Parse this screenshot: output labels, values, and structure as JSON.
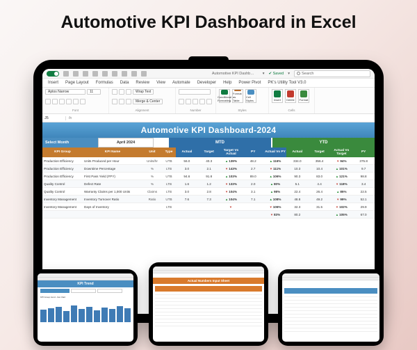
{
  "page_title": "Automotive KPI Dashboard in Excel",
  "qat": {
    "doc_name": "Automotive KPI Dashb…",
    "saved": "Saved",
    "search_placeholder": "Search"
  },
  "tabs": [
    "Insert",
    "Page Layout",
    "Formulas",
    "Data",
    "Review",
    "View",
    "Automate",
    "Developer",
    "Help",
    "Power Pivot",
    "PK's Utility Tool V3.0"
  ],
  "ribbon": {
    "font_family": "Aptos Narrow",
    "font_size": "11",
    "groups": {
      "font": "Font",
      "alignment": "Alignment",
      "number": "Number",
      "styles": "Styles",
      "cells": "Cells"
    },
    "cell_buttons": {
      "cond": "Conditional Formatting",
      "fmt_tbl": "Format as Table",
      "styles": "Cell Styles",
      "insert": "Insert",
      "delete": "Delete",
      "format": "Format"
    },
    "align": {
      "merge": "Merge & Center",
      "wrap": "Wrap Text"
    }
  },
  "formula_bar": {
    "name_box": "J5",
    "fx": "fx"
  },
  "dashboard": {
    "title": "Automotive KPI Dashboard-2024",
    "select_month_label": "Select Month",
    "select_month_value": "April 2024",
    "mtd_label": "MTD",
    "ytd_label": "YTD",
    "columns": {
      "group": "KPI Group",
      "name": "KPI Name",
      "unit": "Unit",
      "type": "Type",
      "actual": "Actual",
      "target": "Target",
      "tva": "Target Vs Actual",
      "py": "PY",
      "avp": "Actual Vs PY",
      "y_actual": "Actual",
      "y_target": "Target",
      "y_tva": "Actual Vs Target",
      "y_py": "PY"
    },
    "rows": [
      {
        "group": "Production Efficiency",
        "name": "Units Produced per Hour",
        "unit": "Units/hr",
        "type": "UTB",
        "m_actual": "56.0",
        "m_target": "40.3",
        "m_tva": "139%",
        "m_tva_dir": "up",
        "m_py": "48.2",
        "m_avp": "116%",
        "m_avp_dir": "up",
        "y_actual": "334.0",
        "y_target": "356.4",
        "y_tva": "94%",
        "y_tva_dir": "dn",
        "y_py": "375.8"
      },
      {
        "group": "Production Efficiency",
        "name": "Downtime Percentage",
        "unit": "%",
        "type": "LTB",
        "m_actual": "3.0",
        "m_target": "2.1",
        "m_tva": "143%",
        "m_tva_dir": "dn",
        "m_py": "2.7",
        "m_avp": "111%",
        "m_avp_dir": "dn",
        "y_actual": "10.3",
        "y_target": "10.4",
        "y_tva": "101%",
        "y_tva_dir": "up",
        "y_py": "9.7"
      },
      {
        "group": "Production Efficiency",
        "name": "First Pass Yield (FPY)",
        "unit": "%",
        "type": "UTB",
        "m_actual": "94.6",
        "m_target": "91.8",
        "m_tva": "103%",
        "m_tva_dir": "up",
        "m_py": "89.0",
        "m_avp": "106%",
        "m_avp_dir": "up",
        "y_actual": "90.3",
        "y_target": "83.0",
        "y_tva": "121%",
        "y_tva_dir": "up",
        "y_py": "98.8"
      },
      {
        "group": "Quality Control",
        "name": "Defect Rate",
        "unit": "%",
        "type": "LTB",
        "m_actual": "1.6",
        "m_target": "1.2",
        "m_tva": "133%",
        "m_tva_dir": "dn",
        "m_py": "2.0",
        "m_avp": "80%",
        "m_avp_dir": "up",
        "y_actual": "5.1",
        "y_target": "4.4",
        "y_tva": "118%",
        "y_tva_dir": "dn",
        "y_py": "3.4"
      },
      {
        "group": "Quality Control",
        "name": "Warranty Claims per 1,000 Units",
        "unit": "Claims",
        "type": "LTB",
        "m_actual": "3.0",
        "m_target": "2.8",
        "m_tva": "104%",
        "m_tva_dir": "dn",
        "m_py": "3.1",
        "m_avp": "98%",
        "m_avp_dir": "up",
        "y_actual": "22.4",
        "y_target": "26.4",
        "y_tva": "85%",
        "y_tva_dir": "up",
        "y_py": "22.5"
      },
      {
        "group": "Inventory Management",
        "name": "Inventory Turnover Ratio",
        "unit": "Ratio",
        "type": "UTB",
        "m_actual": "7.6",
        "m_target": "7.3",
        "m_tva": "104%",
        "m_tva_dir": "up",
        "m_py": "7.1",
        "m_avp": "108%",
        "m_avp_dir": "up",
        "y_actual": "48.8",
        "y_target": "49.2",
        "y_tva": "99%",
        "y_tva_dir": "dn",
        "y_py": "52.1"
      },
      {
        "group": "Inventory Management",
        "name": "Days of Inventory",
        "unit": "",
        "type": "LTB",
        "m_actual": "",
        "m_target": "",
        "m_tva": "",
        "m_tva_dir": "dn",
        "m_py": "",
        "m_avp": "106%",
        "m_avp_dir": "dn",
        "y_actual": "32.3",
        "y_target": "31.5",
        "y_tva": "102%",
        "y_tva_dir": "dn",
        "y_py": "29.9"
      },
      {
        "group": "",
        "name": "",
        "unit": "",
        "type": "",
        "m_actual": "",
        "m_target": "",
        "m_tva": "",
        "m_tva_dir": "",
        "m_py": "",
        "m_avp": "83%",
        "m_avp_dir": "dn",
        "y_actual": "80.2",
        "y_target": "",
        "y_tva": "105%",
        "y_tva_dir": "up",
        "y_py": "67.0"
      }
    ]
  },
  "mini1": {
    "title": "KPI Trend"
  },
  "mini2": {
    "title": "Actual Numbers Input Sheet"
  },
  "mini3": {
    "title": ""
  }
}
